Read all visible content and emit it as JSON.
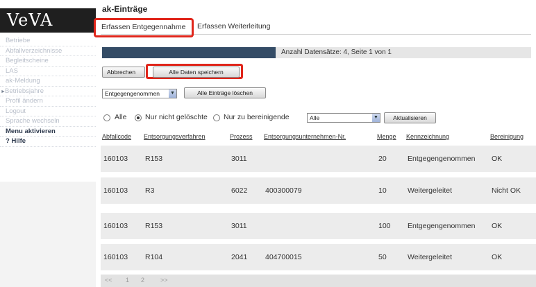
{
  "app": {
    "logo": "VeVA"
  },
  "sidebar": {
    "items": [
      {
        "label": "Betriebe"
      },
      {
        "label": "Abfallverzeichnisse"
      },
      {
        "label": "Begleitscheine"
      },
      {
        "label": "LAS"
      },
      {
        "label": "ak-Meldung"
      },
      {
        "label": "Betriebsjahre"
      },
      {
        "label": "Profil ändern"
      },
      {
        "label": "Logout"
      },
      {
        "label": "Sprache wechseln"
      },
      {
        "label": "Menu aktivieren"
      },
      {
        "label": "? Hilfe"
      }
    ]
  },
  "main": {
    "title": "ak-Einträge",
    "tabs": [
      {
        "label": "Erfassen Entgegennahme"
      },
      {
        "label": "Erfassen Weiterleitung"
      }
    ],
    "info": "Anzahl Datensätze: 4, Seite 1 von 1",
    "buttons": {
      "cancel": "Abbrechen",
      "save_all": "Alle Daten speichern",
      "delete_all": "Alle Einträge löschen",
      "refresh": "Aktualisieren"
    },
    "status_select": "Entgegengenommen",
    "filters": {
      "all": "Alle",
      "not_deleted": "Nur nicht gelöschte",
      "to_clean": "Nur zu bereinigende",
      "select_value": "Alle"
    },
    "table": {
      "columns": [
        "Abfallcode",
        "Entsorgungsverfahren",
        "Prozess",
        "Entsorgungsunternehmen-Nr.",
        "Menge",
        "Kennzeichnung",
        "Bereinigung"
      ],
      "rows": [
        [
          "160103",
          "R153",
          "3011",
          "",
          "20",
          "Entgegengenommen",
          "OK"
        ],
        [
          "160103",
          "R3",
          "6022",
          "400300079",
          "10",
          "Weitergeleitet",
          "Nicht OK"
        ],
        [
          "160103",
          "R153",
          "3011",
          "",
          "100",
          "Entgegengenommen",
          "OK"
        ],
        [
          "160103",
          "R104",
          "2041",
          "404700015",
          "50",
          "Weitergeleitet",
          "OK"
        ]
      ]
    },
    "pager": [
      "<<",
      "1",
      "2",
      ">>"
    ]
  }
}
